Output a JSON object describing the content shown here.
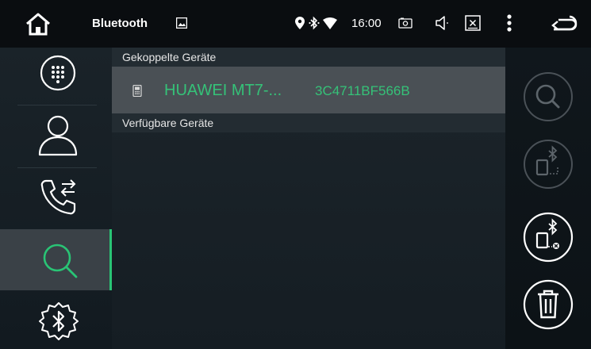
{
  "statusbar": {
    "title": "Bluetooth",
    "time": "16:00",
    "icons": [
      "home-icon",
      "image-icon",
      "location-icon",
      "bluetooth-icon",
      "wifi-icon",
      "screenshot-icon",
      "volume-icon",
      "close-box-icon",
      "more-vert-icon",
      "back-icon"
    ]
  },
  "sidebar": {
    "items": [
      {
        "icon": "dialpad-icon",
        "active": false
      },
      {
        "icon": "contacts-icon",
        "active": false
      },
      {
        "icon": "call-transfer-icon",
        "active": false
      },
      {
        "icon": "search-icon",
        "active": true
      },
      {
        "icon": "bluetooth-settings-icon",
        "active": false
      }
    ]
  },
  "main": {
    "paired_header": "Gekoppelte Geräte",
    "paired_devices": [
      {
        "name": "HUAWEI MT7-...",
        "address": "3C4711BF566B",
        "icon": "phone-icon"
      }
    ],
    "available_header": "Verfügbare Geräte"
  },
  "actions": {
    "icons": [
      "search-icon",
      "bluetooth-phone-connect-icon",
      "bluetooth-phone-disconnect-icon",
      "trash-icon"
    ]
  },
  "colors": {
    "accent": "#29c475",
    "device_text": "#35c278",
    "selected_row": "#4a5055"
  }
}
